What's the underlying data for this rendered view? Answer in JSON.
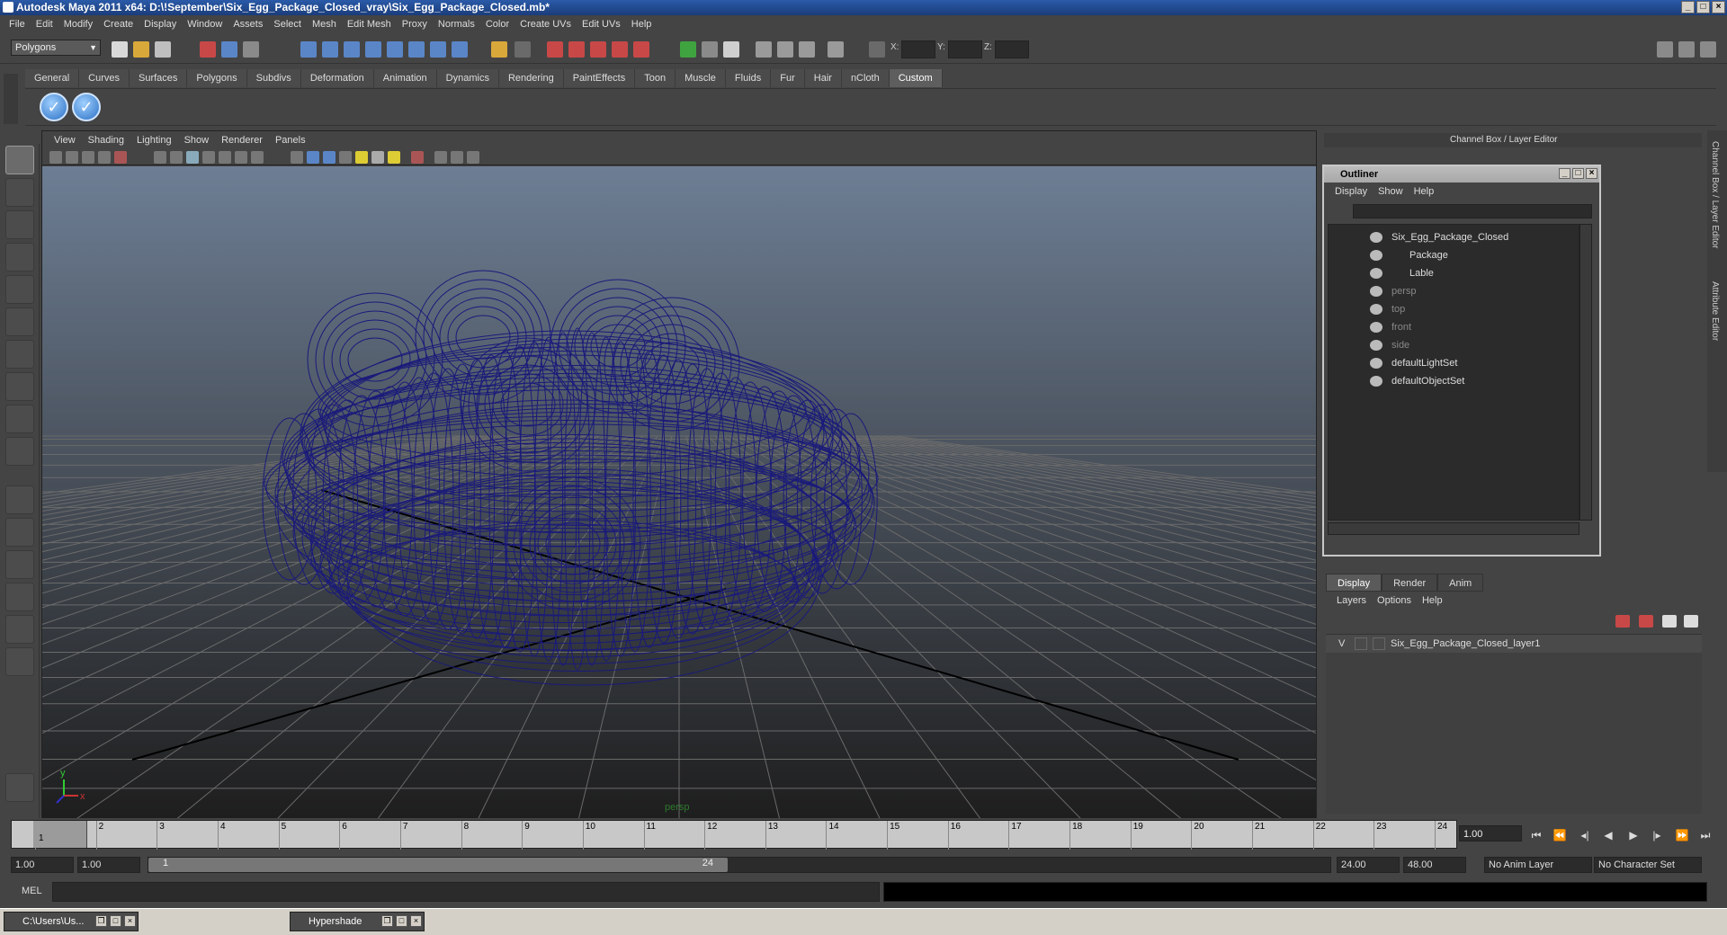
{
  "window": {
    "title": "Autodesk Maya 2011 x64: D:\\!September\\Six_Egg_Package_Closed_vray\\Six_Egg_Package_Closed.mb*"
  },
  "menubar": [
    "File",
    "Edit",
    "Modify",
    "Create",
    "Display",
    "Window",
    "Assets",
    "Select",
    "Mesh",
    "Edit Mesh",
    "Proxy",
    "Normals",
    "Color",
    "Create UVs",
    "Edit UVs",
    "Help"
  ],
  "statusline": {
    "mode": "Polygons",
    "x_label": "X:",
    "y_label": "Y:",
    "z_label": "Z:"
  },
  "shelf": {
    "tabs": [
      "General",
      "Curves",
      "Surfaces",
      "Polygons",
      "Subdivs",
      "Deformation",
      "Animation",
      "Dynamics",
      "Rendering",
      "PaintEffects",
      "Toon",
      "Muscle",
      "Fluids",
      "Fur",
      "Hair",
      "nCloth",
      "Custom"
    ],
    "active_tab": "Custom"
  },
  "viewport": {
    "menu": [
      "View",
      "Shading",
      "Lighting",
      "Show",
      "Renderer",
      "Panels"
    ],
    "camera": "persp",
    "axis_x": "x",
    "axis_y": "y"
  },
  "channel_box": {
    "title": "Channel Box / Layer Editor"
  },
  "side_tabs": [
    "Channel Box / Layer Editor",
    "Attribute Editor"
  ],
  "outliner": {
    "title": "Outliner",
    "menu": [
      "Display",
      "Show",
      "Help"
    ],
    "items": [
      {
        "label": "Six_Egg_Package_Closed",
        "level": 0,
        "dim": false
      },
      {
        "label": "Package",
        "level": 1,
        "dim": false
      },
      {
        "label": "Lable",
        "level": 1,
        "dim": false
      },
      {
        "label": "persp",
        "level": 0,
        "dim": true
      },
      {
        "label": "top",
        "level": 0,
        "dim": true
      },
      {
        "label": "front",
        "level": 0,
        "dim": true
      },
      {
        "label": "side",
        "level": 0,
        "dim": true
      },
      {
        "label": "defaultLightSet",
        "level": 0,
        "dim": false
      },
      {
        "label": "defaultObjectSet",
        "level": 0,
        "dim": false
      }
    ]
  },
  "layer_editor": {
    "tabs": [
      "Display",
      "Render",
      "Anim"
    ],
    "active_tab": "Display",
    "menu": [
      "Layers",
      "Options",
      "Help"
    ],
    "layer": {
      "visible": "V",
      "name": "Six_Egg_Package_Closed_layer1"
    }
  },
  "timeline": {
    "ticks": [
      "1",
      "2",
      "3",
      "4",
      "5",
      "6",
      "7",
      "8",
      "9",
      "10",
      "11",
      "12",
      "13",
      "14",
      "15",
      "16",
      "17",
      "18",
      "19",
      "20",
      "21",
      "22",
      "23",
      "24"
    ],
    "current_frame": "1.00",
    "current_marker": "1"
  },
  "range": {
    "start": "1.00",
    "anim_start": "1.00",
    "range_start": "1",
    "range_end": "24",
    "anim_end_field": "24.00",
    "end_field": "48.00",
    "anim_layer": "No Anim Layer",
    "character_set": "No Character Set"
  },
  "command_line": {
    "label": "MEL"
  },
  "taskbar": [
    {
      "label": "C:\\Users\\Us..."
    },
    {
      "label": "Hypershade"
    }
  ],
  "colors": {
    "wireframe": "#1a1a7a",
    "viewport_top": "#6d7e94",
    "viewport_bottom": "#1e1e1e",
    "grid": "#666666"
  }
}
